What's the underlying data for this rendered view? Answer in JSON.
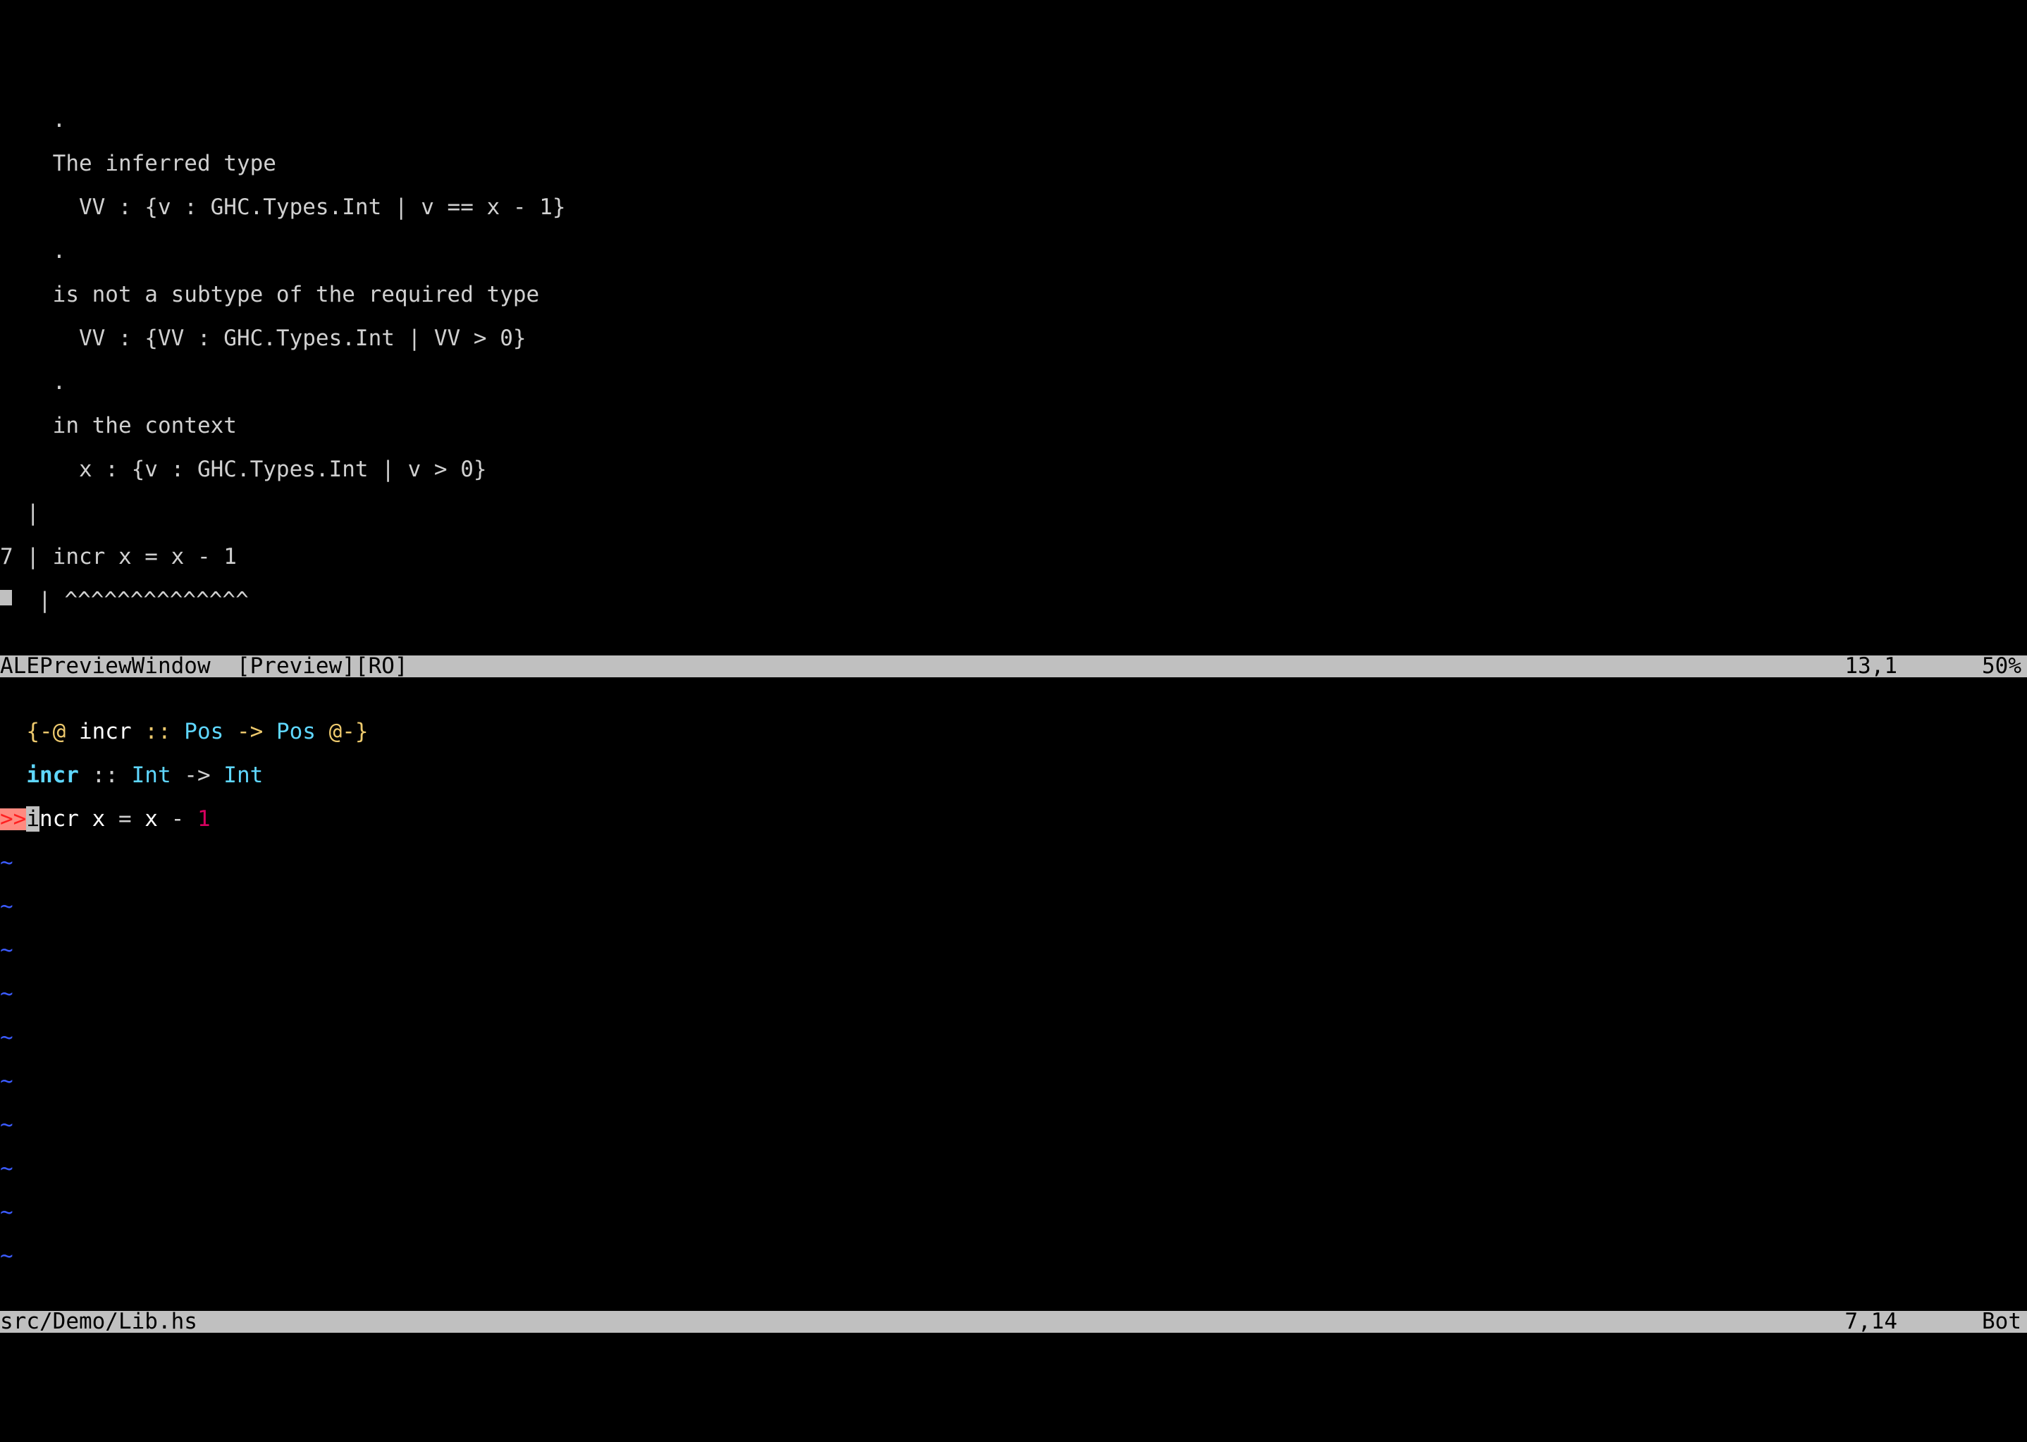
{
  "preview": {
    "lines": [
      "    .",
      "    The inferred type",
      "      VV : {v : GHC.Types.Int | v == x - 1}",
      "    .",
      "    is not a subtype of the required type",
      "      VV : {VV : GHC.Types.Int | VV > 0}",
      "    .",
      "    in the context",
      "      x : {v : GHC.Types.Int | v > 0}",
      "  |",
      "7 | incr x = x - 1",
      "  | ^^^^^^^^^^^^^^"
    ]
  },
  "status_preview": {
    "name": "ALEPreviewWindow",
    "flags": "[Preview][RO]",
    "ruler": "13,1",
    "pct": "50%"
  },
  "editor": {
    "annotation_open": "{-@ ",
    "annotation_fn": "incr",
    "annotation_colons": " :: ",
    "annotation_type1": "Pos",
    "annotation_arrow": " -> ",
    "annotation_type2": "Pos",
    "annotation_close": " @-}",
    "sig_fn": "incr",
    "sig_colons": " :: ",
    "sig_type1": "Int",
    "sig_arrow": " -> ",
    "sig_type2": "Int",
    "sign_error": ">>",
    "def_cursor_char": "i",
    "def_rest": "ncr x ",
    "def_eq": "=",
    "def_expr": " x ",
    "def_minus": "-",
    "def_space": " ",
    "def_num": "1",
    "tilde": "~"
  },
  "status_editor": {
    "filename": "src/Demo/Lib.hs",
    "ruler": "7,14",
    "pct": "Bot"
  }
}
